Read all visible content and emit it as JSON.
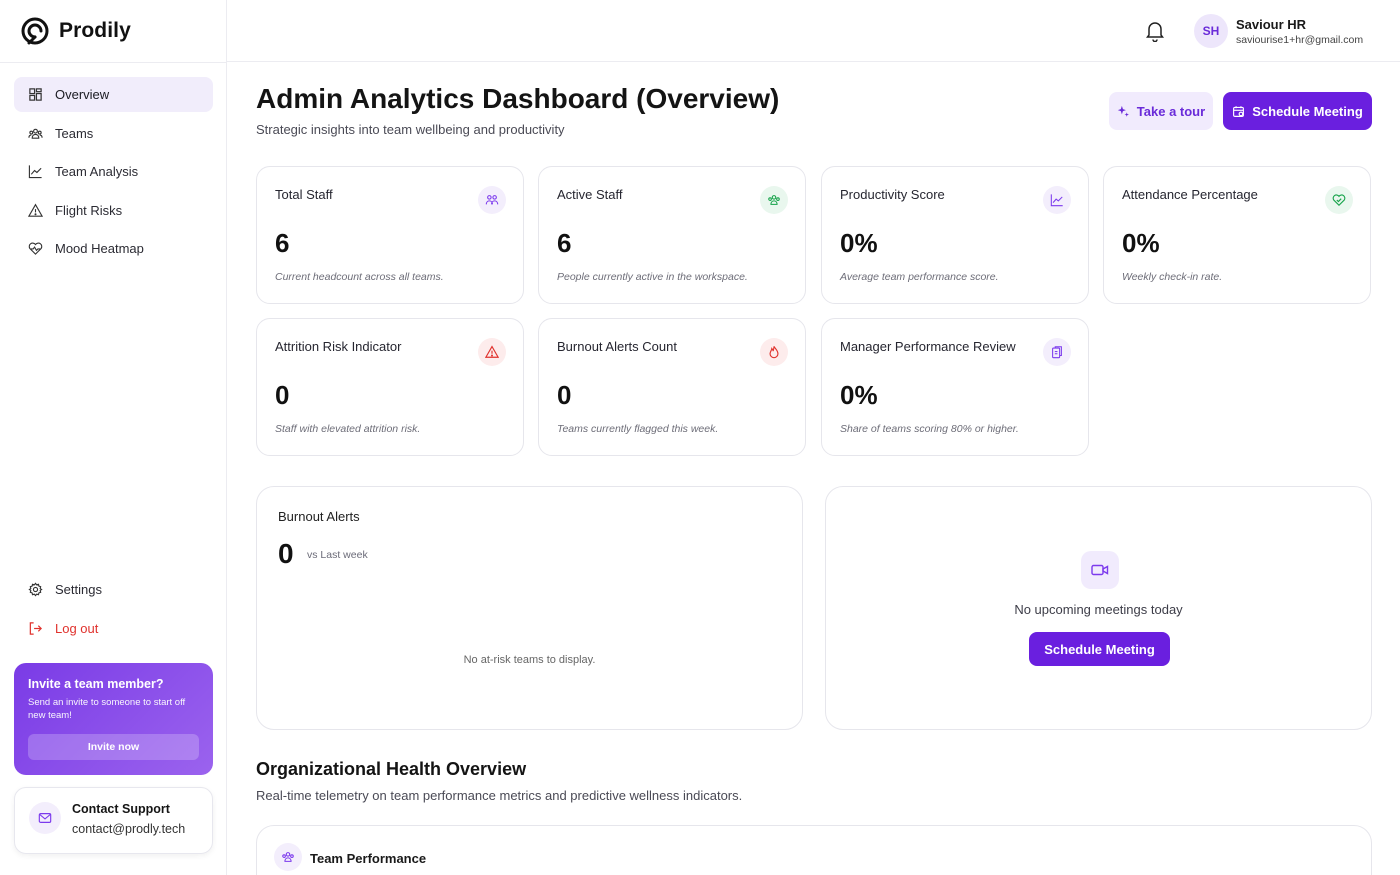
{
  "brand": {
    "name": "Prodily"
  },
  "sidebar": {
    "items": [
      {
        "label": "Overview",
        "icon": "grid-icon",
        "active": true
      },
      {
        "label": "Teams",
        "icon": "users-icon"
      },
      {
        "label": "Team Analysis",
        "icon": "line-chart-icon"
      },
      {
        "label": "Flight Risks",
        "icon": "warning-icon"
      },
      {
        "label": "Mood Heatmap",
        "icon": "heart-pulse-icon"
      }
    ],
    "bottom": [
      {
        "label": "Settings",
        "icon": "gear-icon"
      },
      {
        "label": "Log out",
        "icon": "logout-icon"
      }
    ],
    "invite": {
      "title": "Invite a team member?",
      "text": "Send an invite to someone to start off new team!",
      "button": "Invite now"
    },
    "support": {
      "title": "Contact Support",
      "email": "contact@prodly.tech"
    }
  },
  "topbar": {
    "avatar_initials": "SH",
    "user_name": "Saviour HR",
    "user_email": "saviourise1+hr@gmail.com"
  },
  "header": {
    "title": "Admin Analytics Dashboard (Overview)",
    "subtitle": "Strategic insights into team wellbeing and productivity",
    "tour_button": "Take a tour",
    "schedule_button": "Schedule Meeting"
  },
  "cards": [
    {
      "label": "Total Staff",
      "value": "6",
      "note": "Current headcount across all teams.",
      "icon": "team-icon",
      "color": "#7c3aed"
    },
    {
      "label": "Active Staff",
      "value": "6",
      "note": "People currently active in the workspace.",
      "icon": "active-users-icon",
      "color": "#16a34a"
    },
    {
      "label": "Productivity Score",
      "value": "0%",
      "note": "Average team performance score.",
      "icon": "trend-chart-icon",
      "color": "#7c3aed"
    },
    {
      "label": "Attendance Percentage",
      "value": "0%",
      "note": "Weekly check-in rate.",
      "icon": "heart-check-icon",
      "color": "#16a34a"
    },
    {
      "label": "Attrition Risk Indicator",
      "value": "0",
      "note": "Staff with elevated attrition risk.",
      "icon": "alert-triangle-icon",
      "color": "#e0322d"
    },
    {
      "label": "Burnout Alerts Count",
      "value": "0",
      "note": "Teams currently flagged this week.",
      "icon": "flame-icon",
      "color": "#e0322d"
    },
    {
      "label": "Manager Performance Review",
      "value": "0%",
      "note": "Share of teams scoring 80% or higher.",
      "icon": "clipboard-icon",
      "color": "#7c3aed"
    }
  ],
  "burnout": {
    "title": "Burnout Alerts",
    "value": "0",
    "vs": "vs Last week",
    "empty": "No at-risk teams to display."
  },
  "meetings": {
    "empty": "No upcoming meetings today",
    "button": "Schedule Meeting"
  },
  "org_health": {
    "title": "Organizational Health Overview",
    "subtitle": "Real-time telemetry on team performance metrics and predictive wellness indicators.",
    "card_title": "Team Performance"
  }
}
